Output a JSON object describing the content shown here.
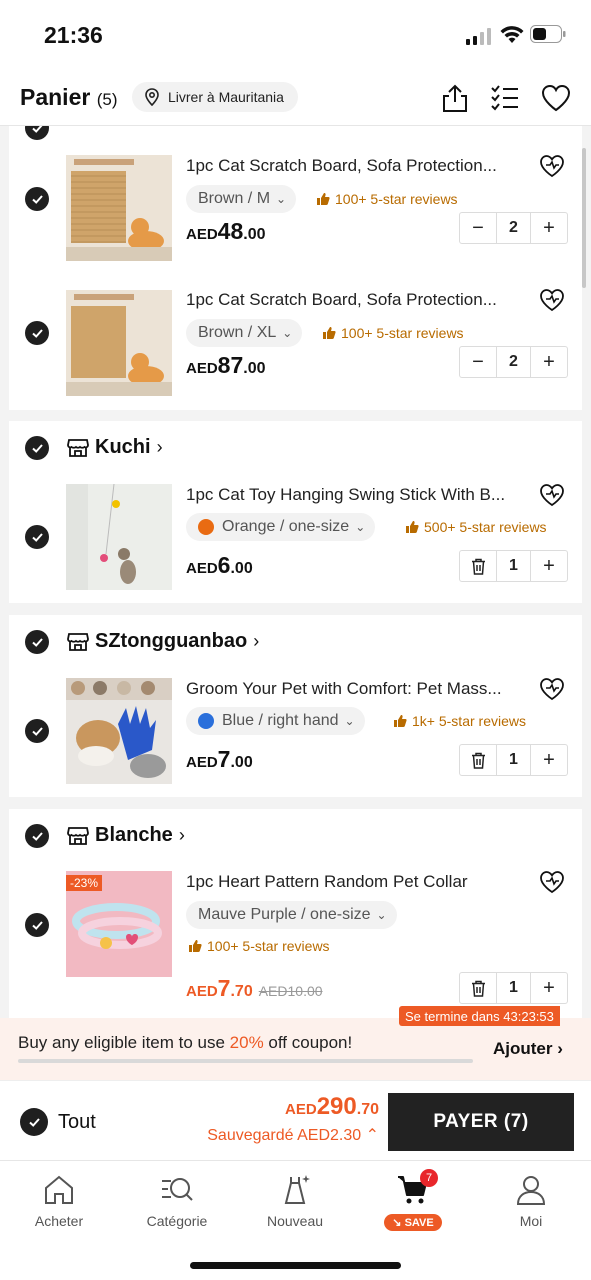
{
  "status_bar": {
    "time": "21:36"
  },
  "header": {
    "title": "Panier",
    "count": "(5)",
    "location": "Livrer à Mauritania",
    "icons": [
      "share-icon",
      "checklist-icon",
      "heart-icon"
    ]
  },
  "stores": [
    {
      "name": "Kuchi"
    },
    {
      "name": "SZtongguanbao"
    },
    {
      "name": "Blanche"
    }
  ],
  "items": [
    {
      "title": "1pc Cat Scratch Board, Sofa Protection...",
      "variant": "Brown / M",
      "reviews": "100+ 5-star reviews",
      "currency": "AED",
      "price_int": "48",
      "price_cents": ".00",
      "qty": "2"
    },
    {
      "title": "1pc Cat Scratch Board, Sofa Protection...",
      "variant": "Brown / XL",
      "reviews": "100+ 5-star reviews",
      "currency": "AED",
      "price_int": "87",
      "price_cents": ".00",
      "qty": "2"
    },
    {
      "title": "1pc Cat Toy Hanging Swing Stick With B...",
      "variant": "Orange / one-size",
      "variant_color": "#e96b12",
      "reviews": "500+ 5-star reviews",
      "currency": "AED",
      "price_int": "6",
      "price_cents": ".00",
      "qty": "1"
    },
    {
      "title": "Groom Your Pet with Comfort: Pet Mass...",
      "variant": "Blue / right hand",
      "variant_color": "#2a6fdb",
      "reviews": "1k+ 5-star reviews",
      "currency": "AED",
      "price_int": "7",
      "price_cents": ".00",
      "qty": "1"
    },
    {
      "title": "1pc Heart Pattern Random Pet Collar",
      "variant": "Mauve Purple / one-size",
      "reviews": "100+ 5-star reviews",
      "currency": "AED",
      "price_int": "7",
      "price_cents": ".70",
      "old_price": "AED10.00",
      "discount": "-23%",
      "qty": "1"
    }
  ],
  "coupon": {
    "timer": "Se termine dans 43:23:53",
    "msg_before": "Buy any eligible item to use ",
    "msg_pct": "20%",
    "msg_after": " off coupon!",
    "action": "Ajouter",
    "progress": 0.0
  },
  "checkout": {
    "select_all": "Tout",
    "total_currency": "AED",
    "total_int": "290",
    "total_cents": ".70",
    "saved": "Sauvegardé AED2.30",
    "pay_label": "PAYER (7)"
  },
  "tabs": [
    {
      "label": "Acheter",
      "icon": "home-icon"
    },
    {
      "label": "Catégorie",
      "icon": "category-search-icon"
    },
    {
      "label": "Nouveau",
      "icon": "new-dress-icon"
    },
    {
      "label": "SAVE",
      "icon": "cart-icon",
      "badge": "7"
    },
    {
      "label": "Moi",
      "icon": "profile-icon"
    }
  ],
  "colors": {
    "accent": "#ed5a25",
    "review": "#b86b00",
    "dark": "#222222"
  }
}
